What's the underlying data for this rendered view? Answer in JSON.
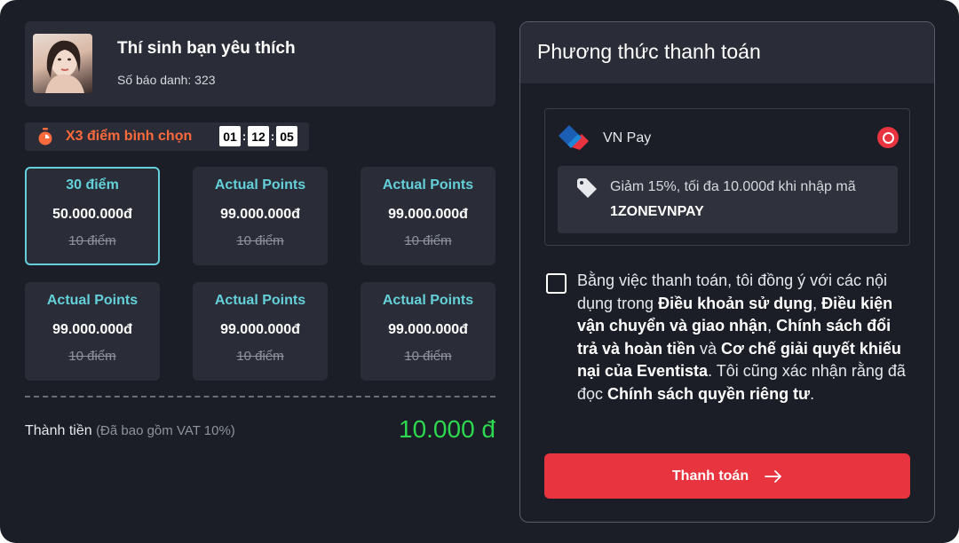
{
  "contestant": {
    "name": "Thí sinh bạn yêu thích",
    "id_label": "Số báo danh: 323"
  },
  "promo": {
    "text": "X3 điểm bình chọn",
    "timer": {
      "hours": "01",
      "minutes": "12",
      "seconds": "05"
    }
  },
  "packages": [
    {
      "points": "30 điểm",
      "price": "50.000.000đ",
      "old": "10 điểm",
      "selected": true
    },
    {
      "points": "Actual Points",
      "price": "99.000.000đ",
      "old": "10 điểm",
      "selected": false
    },
    {
      "points": "Actual Points",
      "price": "99.000.000đ",
      "old": "10 điểm",
      "selected": false
    },
    {
      "points": "Actual Points",
      "price": "99.000.000đ",
      "old": "10 điểm",
      "selected": false
    },
    {
      "points": "Actual Points",
      "price": "99.000.000đ",
      "old": "10 điểm",
      "selected": false
    },
    {
      "points": "Actual Points",
      "price": "99.000.000đ",
      "old": "10 điểm",
      "selected": false
    }
  ],
  "total": {
    "label": "Thành tiền",
    "vat_note": "(Đã bao gồm VAT 10%)",
    "amount": "10.000 đ"
  },
  "payment": {
    "title": "Phương thức thanh toán",
    "method_name": "VN Pay",
    "method_selected": true,
    "coupon_text": "Giảm 15%, tối đa 10.000đ khi nhập mã",
    "coupon_code": "1ZONEVNPAY",
    "terms": {
      "t1": "Bằng việc thanh toán, tôi đồng ý với các nội dụng trong ",
      "b1": "Điều khoản sử dụng",
      "t2": ", ",
      "b2": "Điều kiện vận chuyển và giao nhận",
      "t3": ", ",
      "b3": "Chính sách đổi trả và hoàn tiền",
      "t4": " và ",
      "b4": "Cơ chế giải quyết khiếu nại của Eventista",
      "t5": ". Tôi cũng xác nhận rằng đã đọc ",
      "b5": "Chính sách quyền riêng tư",
      "t6": "."
    },
    "button_label": "Thanh toán"
  },
  "colors": {
    "background": "#1b1e27",
    "card": "#2a2d37",
    "accent_cyan": "#64d0d9",
    "accent_orange": "#ff6a3d",
    "accent_red": "#e8343e",
    "total_green": "#2dd84f"
  },
  "icons": {
    "promo": "stopwatch-icon",
    "method": "vnpay-logo-icon",
    "coupon": "tag-icon",
    "button": "arrow-right-icon"
  }
}
